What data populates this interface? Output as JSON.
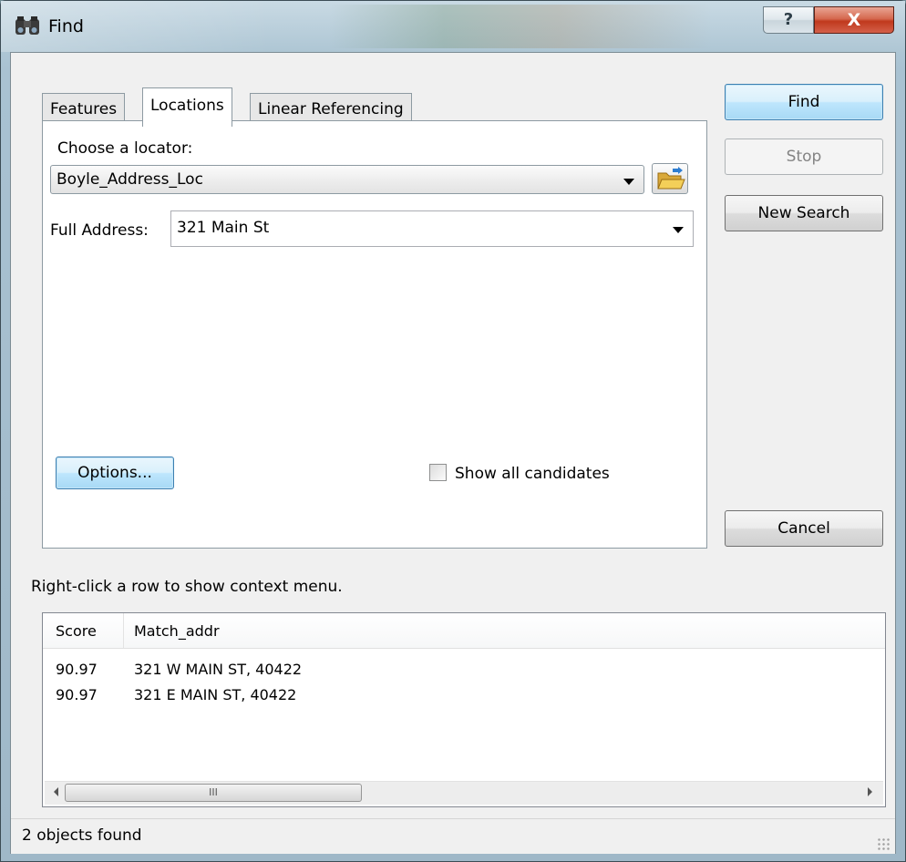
{
  "window": {
    "title": "Find",
    "help_glyph": "?",
    "close_glyph": "X",
    "icon": "binoculars-icon"
  },
  "tabs": [
    {
      "label": "Features",
      "active": false
    },
    {
      "label": "Locations",
      "active": true
    },
    {
      "label": "Linear Referencing",
      "active": false
    }
  ],
  "locations": {
    "locator_label": "Choose a locator:",
    "locator_value": "Boyle_Address_Loc",
    "browse_icon": "folder-icon",
    "address_label": "Full Address:",
    "address_value": "321 Main St",
    "options_label": "Options...",
    "show_all_label": "Show all candidates",
    "show_all_checked": false
  },
  "buttons": {
    "find": "Find",
    "stop": "Stop",
    "new_search": "New Search",
    "cancel": "Cancel"
  },
  "hint": "Right-click a row to show context menu.",
  "results": {
    "columns": [
      "Score",
      "Match_addr"
    ],
    "rows": [
      {
        "score": "90.97",
        "match_addr": "321 W MAIN ST, 40422"
      },
      {
        "score": "90.97",
        "match_addr": "321 E MAIN ST, 40422"
      }
    ],
    "scroll_thumb_glyph": "III"
  },
  "status": "2 objects found"
}
